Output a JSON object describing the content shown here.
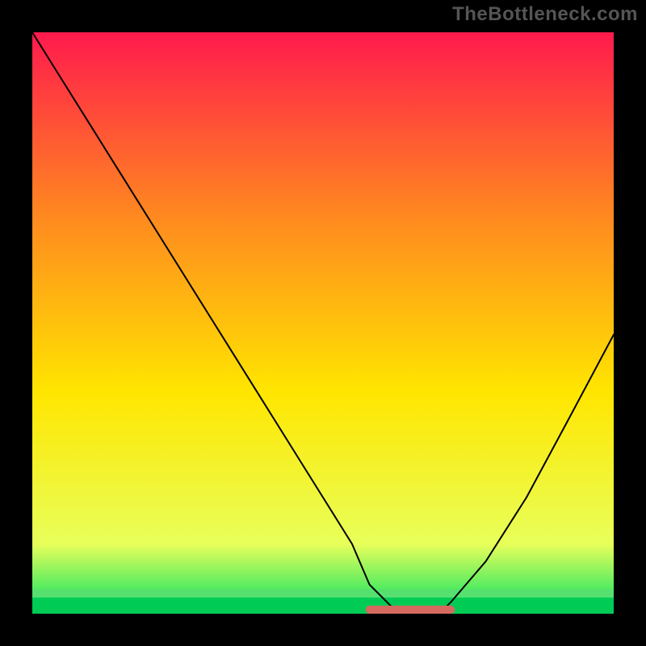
{
  "watermark": "TheBottleneck.com",
  "chart_data": {
    "type": "line",
    "title": "",
    "xlabel": "",
    "ylabel": "",
    "xlim": [
      0,
      100
    ],
    "ylim": [
      0,
      100
    ],
    "grid": false,
    "legend": false,
    "background_gradient": {
      "top": "#ff1a4d",
      "upper_mid": "#ff8a1f",
      "lower_mid": "#ffe600",
      "near_bottom": "#e8ff5a",
      "bottom": "#00e064"
    },
    "series": [
      {
        "name": "bottleneck-curve",
        "color": "#000000",
        "x": [
          0,
          5,
          10,
          15,
          20,
          25,
          30,
          35,
          40,
          45,
          50,
          55,
          58,
          63,
          70,
          72,
          78,
          85,
          92,
          100
        ],
        "y": [
          100,
          92,
          84,
          76,
          68,
          60,
          52,
          44,
          36,
          28,
          20,
          12,
          5,
          0,
          0,
          2,
          9,
          20,
          33,
          48
        ]
      }
    ],
    "annotations": [
      {
        "name": "optimal-flat-segment",
        "color": "#d46a5f",
        "x_range": [
          58,
          72
        ],
        "y": 0
      }
    ]
  }
}
